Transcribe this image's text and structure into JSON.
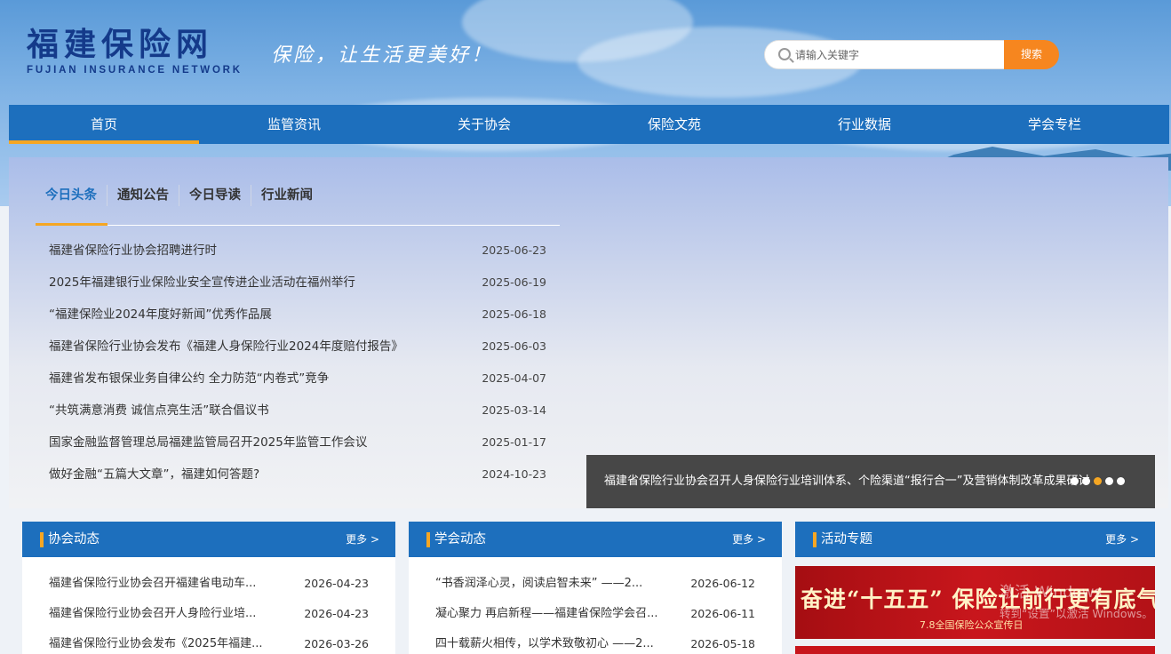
{
  "site": {
    "logo_cn": "福建保险网",
    "logo_en": "FUJIAN INSURANCE NETWORK",
    "slogan": "保险，让生活更美好！"
  },
  "search": {
    "placeholder": "请输入关键字",
    "button": "搜索"
  },
  "nav": [
    "首页",
    "监管资讯",
    "关于协会",
    "保险文苑",
    "行业数据",
    "学会专栏"
  ],
  "main": {
    "tabs": [
      "今日头条",
      "通知公告",
      "今日导读",
      "行业新闻"
    ],
    "news": [
      {
        "title": "福建省保险行业协会招聘进行时",
        "date": "2025-06-23"
      },
      {
        "title": "2025年福建银行业保险业安全宣传进企业活动在福州举行",
        "date": "2025-06-19"
      },
      {
        "title": "“福建保险业2024年度好新闻”优秀作品展",
        "date": "2025-06-18"
      },
      {
        "title": "福建省保险行业协会发布《福建人身保险行业2024年度赔付报告》",
        "date": "2025-06-03"
      },
      {
        "title": "福建省发布银保业务自律公约 全力防范“内卷式”竞争",
        "date": "2025-04-07"
      },
      {
        "title": "“共筑满意消费 诚信点亮生活”联合倡议书",
        "date": "2025-03-14"
      },
      {
        "title": "国家金融监督管理总局福建监管局召开2025年监管工作会议",
        "date": "2025-01-17"
      },
      {
        "title": "做好金融“五篇大文章”，福建如何答题?",
        "date": "2024-10-23"
      }
    ],
    "slide_caption": "福建省保险行业协会召开人身保险行业培训体系、个险渠道“报行合一”及营销体制改革成果研讨"
  },
  "cards": [
    {
      "title": "协会动态",
      "more": "更多 >",
      "items": [
        {
          "title": "福建省保险行业协会召开福建省电动车...",
          "date": "2026-04-23"
        },
        {
          "title": "福建省保险行业协会召开人身险行业培...",
          "date": "2026-04-23"
        },
        {
          "title": "福建省保险行业协会发布《2025年福建...",
          "date": "2026-03-26"
        }
      ]
    },
    {
      "title": "学会动态",
      "more": "更多 >",
      "items": [
        {
          "title": "“书香润泽心灵，阅读启智未来” ——2...",
          "date": "2026-06-12"
        },
        {
          "title": "凝心聚力 再启新程——福建省保险学会召...",
          "date": "2026-06-11"
        },
        {
          "title": "四十载薪火相传，以学术致敬初心 ——2...",
          "date": "2026-05-18"
        }
      ]
    },
    {
      "title": "活动专题",
      "more": "更多 >",
      "banner_main": "奋进“十五五” 保险让前行更有底气",
      "banner_sub": "7.8全国保险公众宣传日"
    }
  ],
  "watermark": {
    "line1": "激活 Windows",
    "line2": "转到“设置”以激活 Windows。"
  }
}
